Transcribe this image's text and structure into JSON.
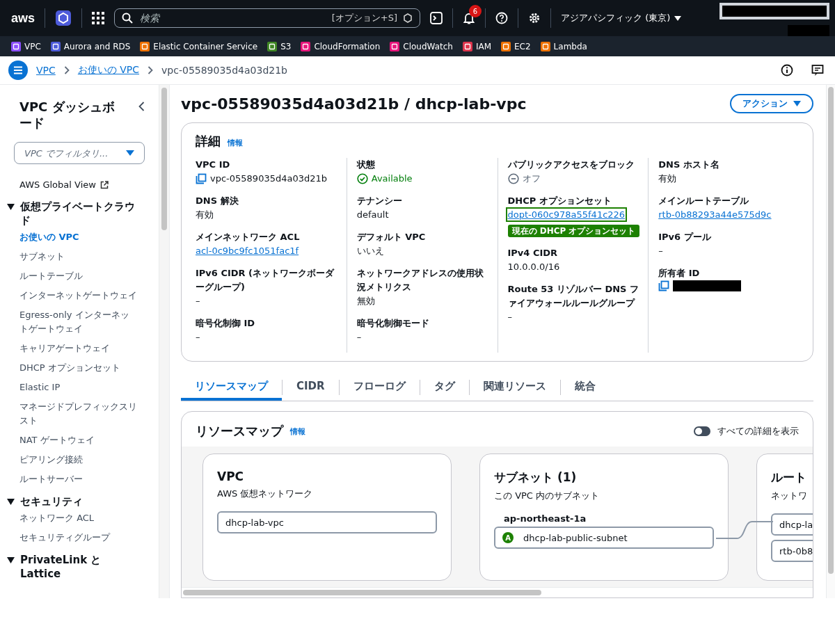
{
  "top_nav": {
    "logo": "aws",
    "search": {
      "placeholder": "検索",
      "shortcut": "[オプション+S]"
    },
    "notifications": "6",
    "region": "アジアパシフィック (東京)"
  },
  "favorites": [
    {
      "label": "VPC",
      "color": "#8c4fff"
    },
    {
      "label": "Aurora and RDS",
      "color": "#4d5bd9"
    },
    {
      "label": "Elastic Container Service",
      "color": "#ed7100"
    },
    {
      "label": "S3",
      "color": "#3f8624"
    },
    {
      "label": "CloudFormation",
      "color": "#e7157b"
    },
    {
      "label": "CloudWatch",
      "color": "#e7157b"
    },
    {
      "label": "IAM",
      "color": "#dd344c"
    },
    {
      "label": "EC2",
      "color": "#ed7100"
    },
    {
      "label": "Lambda",
      "color": "#ed7100"
    }
  ],
  "breadcrumbs": [
    "VPC",
    "お使いの VPC",
    "vpc-05589035d4a03d21b"
  ],
  "sidebar": {
    "title": "VPC ダッシュボード",
    "filter": {
      "placeholder": "VPC でフィルタリ..."
    },
    "global_view": "AWS Global View",
    "sections": [
      {
        "label": "仮想プライベートクラウド",
        "expanded": true,
        "items": [
          {
            "label": "お使いの VPC",
            "selected": true
          },
          {
            "label": "サブネット",
            "selected": false
          },
          {
            "label": "ルートテーブル",
            "selected": false
          },
          {
            "label": "インターネットゲートウェイ",
            "selected": false
          },
          {
            "label": "Egress-only インターネットゲートウェイ",
            "selected": false
          },
          {
            "label": "キャリアゲートウェイ",
            "selected": false
          },
          {
            "label": "DHCP オプションセット",
            "selected": false
          },
          {
            "label": "Elastic IP",
            "selected": false
          },
          {
            "label": "マネージドプレフィックスリスト",
            "selected": false
          },
          {
            "label": "NAT ゲートウェイ",
            "selected": false
          },
          {
            "label": "ピアリング接続",
            "selected": false
          },
          {
            "label": "ルートサーバー",
            "selected": false
          }
        ]
      },
      {
        "label": "セキュリティ",
        "expanded": true,
        "items": [
          {
            "label": "ネットワーク ACL",
            "selected": false
          },
          {
            "label": "セキュリティグループ",
            "selected": false
          }
        ]
      },
      {
        "label": "PrivateLink と Lattice",
        "expanded": true
      }
    ]
  },
  "page_title": "vpc-05589035d4a03d21b / dhcp-lab-vpc",
  "actions_button": "アクション",
  "details": {
    "title": "詳細",
    "info": "情報",
    "columns": [
      [
        {
          "label": "VPC ID",
          "kind": "copy",
          "value": "vpc-05589035d4a03d21b"
        },
        {
          "label": "DNS 解決",
          "kind": "text",
          "value": "有効"
        },
        {
          "label": "メインネットワーク ACL",
          "kind": "link",
          "value": "acl-0c9bc9fc1051fac1f"
        },
        {
          "label": "IPv6 CIDR (ネットワークボーダーグループ)",
          "kind": "text",
          "value": "–"
        },
        {
          "label": "暗号化制御 ID",
          "kind": "text",
          "value": "–"
        }
      ],
      [
        {
          "label": "状態",
          "kind": "status",
          "value": "Available"
        },
        {
          "label": "テナンシー",
          "kind": "text",
          "value": "default"
        },
        {
          "label": "デフォルト VPC",
          "kind": "text",
          "value": "いいえ"
        },
        {
          "label": "ネットワークアドレスの使用状況メトリクス",
          "kind": "text",
          "value": "無効"
        },
        {
          "label": "暗号化制御モード",
          "kind": "text",
          "value": "–"
        }
      ],
      [
        {
          "label": "パブリックアクセスをブロック",
          "kind": "off",
          "value": "オフ"
        },
        {
          "label": "DHCP オプションセット",
          "kind": "link",
          "value": "dopt-060c978a55f41c226",
          "tooltip": "現在の DHCP オプションセット"
        },
        {
          "label": "IPv4 CIDR",
          "kind": "text",
          "value": "10.0.0.0/16"
        },
        {
          "label": "Route 53 リゾルバー DNS ファイアウォールルールグループ",
          "kind": "text",
          "value": "–"
        }
      ],
      [
        {
          "label": "DNS ホスト名",
          "kind": "text",
          "value": "有効"
        },
        {
          "label": "メインルートテーブル",
          "kind": "link",
          "value": "rtb-0b88293a44e575d9c"
        },
        {
          "label": "IPv6 プール",
          "kind": "text",
          "value": "–"
        },
        {
          "label": "所有者 ID",
          "kind": "redacted"
        }
      ]
    ]
  },
  "tabs": [
    {
      "label": "リソースマップ",
      "selected": true
    },
    {
      "label": "CIDR",
      "selected": false
    },
    {
      "label": "フローログ",
      "selected": false
    },
    {
      "label": "タグ",
      "selected": false
    },
    {
      "label": "関連リソース",
      "selected": false
    },
    {
      "label": "統合",
      "selected": false
    }
  ],
  "resource_map": {
    "title": "リソースマップ",
    "info": "情報",
    "toggle": {
      "label": "すべての詳細を表示",
      "on": false
    },
    "cards": [
      {
        "title": "VPC",
        "subtitle": "AWS 仮想ネットワーク",
        "groups": [
          {
            "nodes": [
              {
                "label": "dhcp-lab-vpc"
              }
            ]
          }
        ]
      },
      {
        "title": "サブネット (1)",
        "subtitle": "この VPC 内のサブネット",
        "groups": [
          {
            "label": "ap-northeast-1a",
            "nodes": [
              {
                "label": "dhcp-lab-public-subnet",
                "badge": "A"
              }
            ]
          }
        ]
      },
      {
        "title": "ルート",
        "subtitle": "ネットワ",
        "groups": [
          {
            "nodes": [
              {
                "label": "dhcp-la"
              },
              {
                "label": "rtb-0b8"
              }
            ]
          }
        ]
      }
    ]
  }
}
